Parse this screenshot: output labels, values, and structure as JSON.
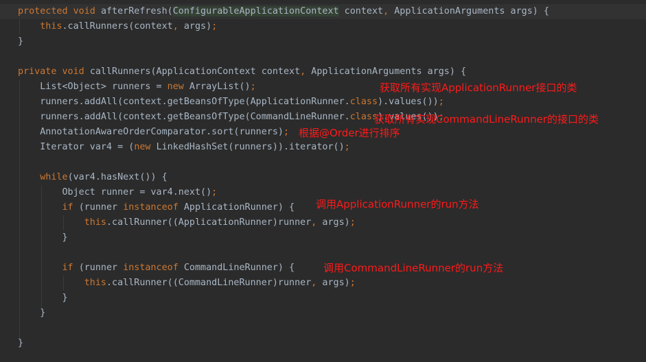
{
  "code_lines": [
    [
      [
        "k",
        "protected void "
      ],
      [
        "t",
        "afterRefresh("
      ],
      [
        "h",
        "ConfigurableApplicationContext"
      ],
      [
        "t",
        " context"
      ],
      [
        "p",
        ", "
      ],
      [
        "t",
        "ApplicationArguments args) {"
      ]
    ],
    [
      [
        "t",
        "    "
      ],
      [
        "k",
        "this"
      ],
      [
        "t",
        ".callRunners(context"
      ],
      [
        "p",
        ", "
      ],
      [
        "t",
        "args)"
      ],
      [
        "p",
        ";"
      ]
    ],
    [
      [
        "t",
        "}"
      ]
    ],
    [],
    [
      [
        "k",
        "private void "
      ],
      [
        "t",
        "callRunners(ApplicationContext context"
      ],
      [
        "p",
        ", "
      ],
      [
        "t",
        "ApplicationArguments args) {"
      ]
    ],
    [
      [
        "t",
        "    List<Object> runners = "
      ],
      [
        "k",
        "new "
      ],
      [
        "t",
        "ArrayList()"
      ],
      [
        "p",
        ";"
      ]
    ],
    [
      [
        "t",
        "    runners.addAll(context.getBeansOfType(ApplicationRunner."
      ],
      [
        "k",
        "class"
      ],
      [
        "t",
        ").values())"
      ],
      [
        "p",
        ";"
      ]
    ],
    [
      [
        "t",
        "    runners.addAll(context.getBeansOfType(CommandLineRunner."
      ],
      [
        "k",
        "class"
      ],
      [
        "t",
        ").values())"
      ],
      [
        "p",
        ";"
      ]
    ],
    [
      [
        "t",
        "    AnnotationAwareOrderComparator.sort(runners)"
      ],
      [
        "p",
        ";"
      ]
    ],
    [
      [
        "t",
        "    Iterator var4 = ("
      ],
      [
        "k",
        "new "
      ],
      [
        "t",
        "LinkedHashSet(runners)).iterator()"
      ],
      [
        "p",
        ";"
      ]
    ],
    [],
    [
      [
        "t",
        "    "
      ],
      [
        "k",
        "while"
      ],
      [
        "t",
        "(var4.hasNext()) {"
      ]
    ],
    [
      [
        "t",
        "        Object runner = var4.next()"
      ],
      [
        "p",
        ";"
      ]
    ],
    [
      [
        "t",
        "        "
      ],
      [
        "k",
        "if "
      ],
      [
        "t",
        "(runner "
      ],
      [
        "k",
        "instanceof "
      ],
      [
        "t",
        "ApplicationRunner) {"
      ]
    ],
    [
      [
        "t",
        "            "
      ],
      [
        "k",
        "this"
      ],
      [
        "t",
        ".callRunner((ApplicationRunner)runner"
      ],
      [
        "p",
        ", "
      ],
      [
        "t",
        "args)"
      ],
      [
        "p",
        ";"
      ]
    ],
    [
      [
        "t",
        "        }"
      ]
    ],
    [],
    [
      [
        "t",
        "        "
      ],
      [
        "k",
        "if "
      ],
      [
        "t",
        "(runner "
      ],
      [
        "k",
        "instanceof "
      ],
      [
        "t",
        "CommandLineRunner) {"
      ]
    ],
    [
      [
        "t",
        "            "
      ],
      [
        "k",
        "this"
      ],
      [
        "t",
        ".callRunner((CommandLineRunner)runner"
      ],
      [
        "p",
        ", "
      ],
      [
        "t",
        "args)"
      ],
      [
        "p",
        ";"
      ]
    ],
    [
      [
        "t",
        "        }"
      ]
    ],
    [
      [
        "t",
        "    }"
      ]
    ],
    [],
    [
      [
        "t",
        "}"
      ]
    ]
  ],
  "annotations": [
    "获取所有实现ApplicationRunner接口的类",
    "获取所有实现CommandLineRunner的接口的类",
    "根据@Order进行排序",
    "调用ApplicationRunner的run方法",
    "调用CommandLineRunner的run方法"
  ],
  "colors": {
    "background": "#2b2b2b",
    "keyword": "#cc7832",
    "text": "#a9b7c6",
    "annotation": "#ff1a1a"
  }
}
